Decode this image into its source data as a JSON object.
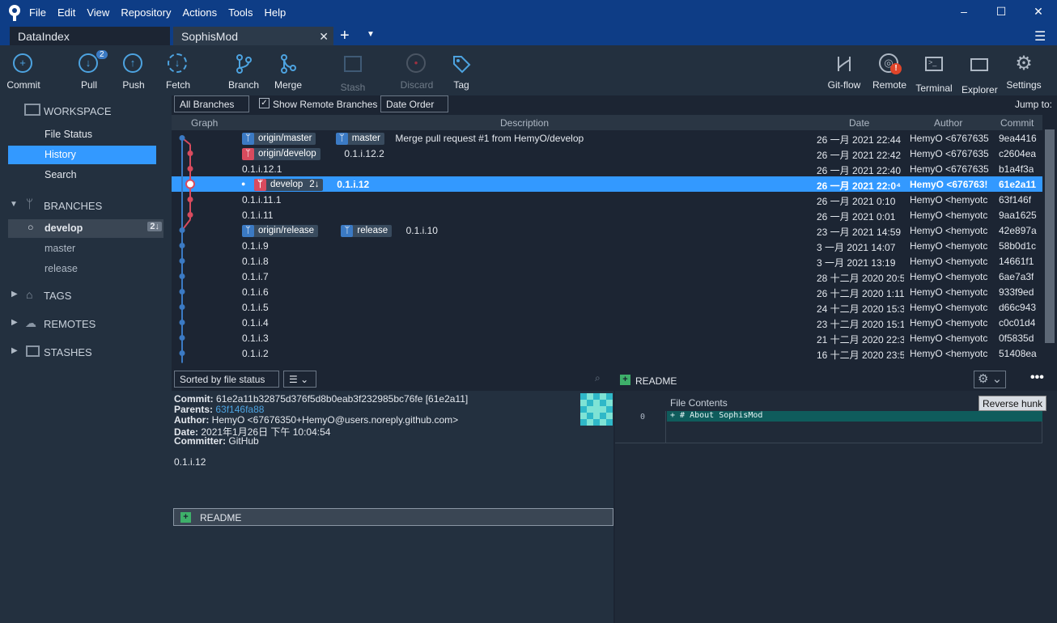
{
  "menu": [
    "File",
    "Edit",
    "View",
    "Repository",
    "Actions",
    "Tools",
    "Help"
  ],
  "tabs": [
    {
      "label": "DataIndex"
    },
    {
      "label": "SophisMod"
    }
  ],
  "toolbar": {
    "commit": "Commit",
    "pull": "Pull",
    "pull_badge": "2",
    "push": "Push",
    "fetch": "Fetch",
    "branch": "Branch",
    "merge": "Merge",
    "stash": "Stash",
    "discard": "Discard",
    "tag": "Tag",
    "gitflow": "Git-flow",
    "remote": "Remote",
    "terminal": "Terminal",
    "explorer": "Explorer",
    "settings": "Settings"
  },
  "sidebar": {
    "workspace": "WORKSPACE",
    "file_status": "File Status",
    "history": "History",
    "search": "Search",
    "branches": "BRANCHES",
    "branch_items": [
      {
        "label": "develop",
        "badge": "2↓"
      },
      {
        "label": "master"
      },
      {
        "label": "release"
      }
    ],
    "tags": "TAGS",
    "remotes": "REMOTES",
    "stashes": "STASHES"
  },
  "filters": {
    "branches": "All Branches ⌄",
    "show_remote": "Show Remote Branches",
    "order": "Date Order ⌄",
    "jump": "Jump to:"
  },
  "columns": {
    "graph": "Graph",
    "description": "Description",
    "date": "Date",
    "author": "Author",
    "commit": "Commit"
  },
  "commits": [
    {
      "badges": [
        {
          "t": "origin/master",
          "c": "blue"
        },
        {
          "t": "master",
          "c": "blue"
        }
      ],
      "desc": "Merge pull request #1 from HemyO/develop",
      "date": "26 一月 2021 22:44",
      "author": "HemyO <6767635(",
      "hash": "9ea4416"
    },
    {
      "badges": [
        {
          "t": "origin/develop",
          "c": "red"
        }
      ],
      "desc": "0.1.i.12.2",
      "date": "26 一月 2021 22:42",
      "author": "HemyO <6767635(",
      "hash": "c2604ea"
    },
    {
      "badges": [],
      "desc": "0.1.i.12.1",
      "date": "26 一月 2021 22:40",
      "author": "HemyO <6767635(",
      "hash": "b1a4f3a"
    },
    {
      "badges": [
        {
          "t": "develop",
          "c": "red",
          "extra": "2↓"
        }
      ],
      "desc": "0.1.i.12",
      "date": "26 一月 2021 22:0⁴",
      "author": "HemyO <676763!",
      "hash": "61e2a11",
      "selected": true
    },
    {
      "badges": [],
      "desc": "0.1.i.11.1",
      "date": "26 一月 2021 0:10",
      "author": "HemyO <hemyotc",
      "hash": "63f146f"
    },
    {
      "badges": [],
      "desc": "0.1.i.11",
      "date": "26 一月 2021 0:01",
      "author": "HemyO <hemyotc",
      "hash": "9aa1625"
    },
    {
      "badges": [
        {
          "t": "origin/release",
          "c": "blue"
        },
        {
          "t": "release",
          "c": "blue"
        }
      ],
      "desc": "0.1.i.10",
      "date": "23 一月 2021 14:59",
      "author": "HemyO <hemyotc",
      "hash": "42e897a"
    },
    {
      "badges": [],
      "desc": "0.1.i.9",
      "date": "3 一月 2021 14:07",
      "author": "HemyO <hemyotc",
      "hash": "58b0d1c"
    },
    {
      "badges": [],
      "desc": "0.1.i.8",
      "date": "3 一月 2021 13:19",
      "author": "HemyO <hemyotc",
      "hash": "14661f1"
    },
    {
      "badges": [],
      "desc": "0.1.i.7",
      "date": "28 十二月 2020 20:5",
      "author": "HemyO <hemyotc",
      "hash": "6ae7a3f"
    },
    {
      "badges": [],
      "desc": "0.1.i.6",
      "date": "26 十二月 2020 1:11",
      "author": "HemyO <hemyotc",
      "hash": "933f9ed"
    },
    {
      "badges": [],
      "desc": "0.1.i.5",
      "date": "24 十二月 2020 15:3",
      "author": "HemyO <hemyotc",
      "hash": "d66c943"
    },
    {
      "badges": [],
      "desc": "0.1.i.4",
      "date": "23 十二月 2020 15:1",
      "author": "HemyO <hemyotc",
      "hash": "c0c01d4"
    },
    {
      "badges": [],
      "desc": "0.1.i.3",
      "date": "21 十二月 2020 22:3",
      "author": "HemyO <hemyotc",
      "hash": "0f5835d"
    },
    {
      "badges": [],
      "desc": "0.1.i.2",
      "date": "16 十二月 2020 23:5",
      "author": "HemyO <hemyotc",
      "hash": "51408ea"
    }
  ],
  "details": {
    "sort": "Sorted by file status ⌄",
    "view": "☰ ⌄",
    "commit_label": "Commit:",
    "commit": "61e2a11b32875d376f5d8b0eab3f232985bc76fe [61e2a11]",
    "parents_label": "Parents:",
    "parents": "63f146fa88",
    "author_label": "Author:",
    "author": "HemyO <67676350+HemyO@users.noreply.github.com>",
    "date_label": "Date:",
    "date": "2021年1月26日 下午 10:04:54",
    "committer_label": "Committer:",
    "committer": "GitHub",
    "message": "0.1.i.12",
    "file": "README"
  },
  "diff": {
    "file": "README",
    "header": "File Contents",
    "reverse": "Reverse hunk",
    "line_no": "0",
    "line": "+ # About SophisMod"
  },
  "colors": {
    "accent": "#3399ff",
    "titlebar": "#0e3d86",
    "branch_red": "#d84b5e",
    "branch_blue": "#3b7ac4"
  }
}
